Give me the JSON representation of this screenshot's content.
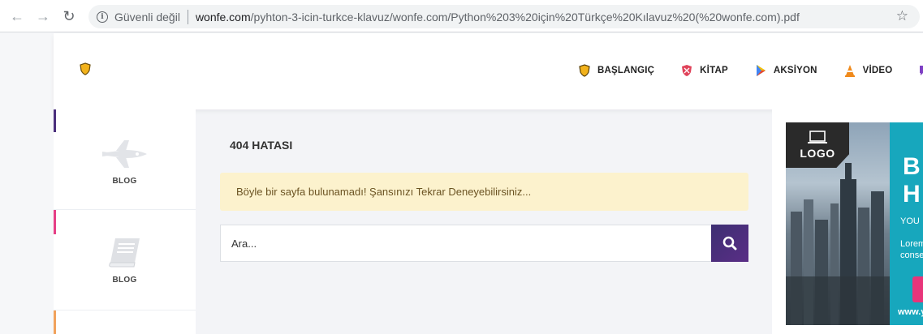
{
  "browser": {
    "security_label": "Güvenli değil",
    "url_host": "wonfe.com",
    "url_path": "/pyhton-3-icin-turkce-klavuz/wonfe.com/Python%203%20için%20Türkçe%20Kılavuz%20(%20wonfe.com).pdf"
  },
  "nav": {
    "items": [
      {
        "label": "BAŞLANGIÇ",
        "icon": "shield-icon"
      },
      {
        "label": "KİTAP",
        "icon": "shield-icon"
      },
      {
        "label": "AKSİYON",
        "icon": "play-icon"
      },
      {
        "label": "VİDEO",
        "icon": "cone-icon"
      }
    ]
  },
  "sidebar": {
    "items": [
      {
        "label": "BLOG",
        "icon": "shuttle-icon"
      },
      {
        "label": "BLOG",
        "icon": "book-icon"
      }
    ]
  },
  "main": {
    "error_title": "404 HATASI",
    "alert_text": "Böyle bir sayfa bulunamadı! Şansınızı Tekrar Deneyebilirsiniz...",
    "search_placeholder": "Ara..."
  },
  "ad": {
    "logo_text": "LOGO",
    "big_lines": [
      "B",
      "H"
    ],
    "small_lines": [
      "YOU",
      "Lorem",
      "conse"
    ],
    "url_text": "www.y"
  },
  "colors": {
    "accent_purple": "#4a2e7c",
    "alert_bg": "#fcf2cd",
    "ad_teal": "#17a7bd"
  }
}
